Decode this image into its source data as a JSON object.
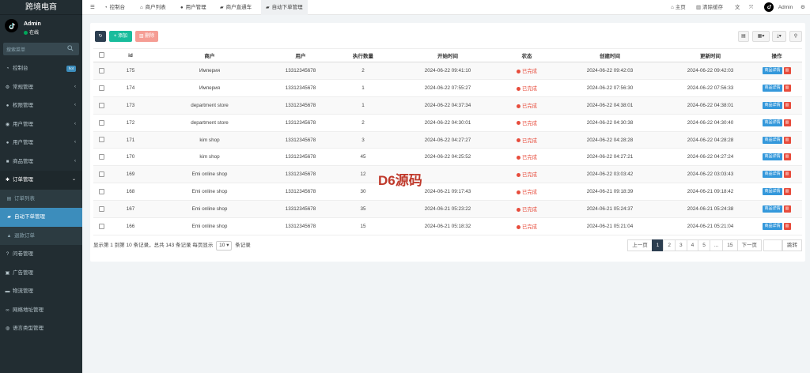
{
  "brand": "跨境电商",
  "user": {
    "name": "Admin",
    "status": "在线"
  },
  "search": {
    "placeholder": "搜索菜单"
  },
  "menu": [
    {
      "label": "控制台",
      "icon": "dashboard-icon",
      "badge": "hot"
    },
    {
      "label": "常规管理",
      "icon": "gears-icon"
    },
    {
      "label": "权限管理",
      "icon": "group-icon"
    },
    {
      "label": "用户管理",
      "icon": "user-icon"
    },
    {
      "label": "用户管理",
      "icon": "apple-icon"
    },
    {
      "label": "商品管理",
      "icon": "gift-icon"
    },
    {
      "label": "订单管理",
      "icon": "gear-icon"
    },
    {
      "label": "订单列表",
      "icon": "list-icon"
    },
    {
      "label": "自动下单管理",
      "icon": "car-icon"
    },
    {
      "label": "退款订单",
      "icon": "bank-icon"
    },
    {
      "label": "问卷管理",
      "icon": "question-icon"
    },
    {
      "label": "广告管理",
      "icon": "image-icon"
    },
    {
      "label": "物流管理",
      "icon": "truck-icon"
    },
    {
      "label": "网络地址管理",
      "icon": "link-icon"
    },
    {
      "label": "语言类型管理",
      "icon": "globe-icon"
    }
  ],
  "tabs": [
    {
      "label": "控制台",
      "icon": "dashboard-icon"
    },
    {
      "label": "商户列表",
      "icon": "home-icon"
    },
    {
      "label": "用户管理",
      "icon": "user-icon"
    },
    {
      "label": "商户直通车",
      "icon": "car-icon"
    },
    {
      "label": "自动下单管理",
      "icon": "car-icon"
    }
  ],
  "topright": {
    "home": "主页",
    "clear_cache": "清除缓存",
    "admin": "Admin"
  },
  "toolbar": {
    "add": "添加",
    "delete": "删除"
  },
  "table": {
    "headers": [
      "id",
      "商户",
      "用户",
      "执行数量",
      "开始时间",
      "状态",
      "创建时间",
      "更新时间",
      "操作"
    ],
    "rows": [
      {
        "id": "175",
        "merchant": "Империя",
        "user": "13312345678",
        "qty": "2",
        "start": "2024-06-22 09:41:10",
        "status": "已完成",
        "created": "2024-06-22 09:42:03",
        "updated": "2024-06-22 09:42:03"
      },
      {
        "id": "174",
        "merchant": "Империя",
        "user": "13312345678",
        "qty": "1",
        "start": "2024-06-22 07:55:27",
        "status": "已完成",
        "created": "2024-06-22 07:56:30",
        "updated": "2024-06-22 07:56:33"
      },
      {
        "id": "173",
        "merchant": "department store",
        "user": "13312345678",
        "qty": "1",
        "start": "2024-06-22 04:37:34",
        "status": "已完成",
        "created": "2024-06-22 04:38:01",
        "updated": "2024-06-22 04:38:01"
      },
      {
        "id": "172",
        "merchant": "department store",
        "user": "13312345678",
        "qty": "2",
        "start": "2024-06-22 04:30:01",
        "status": "已完成",
        "created": "2024-06-22 04:30:38",
        "updated": "2024-06-22 04:30:40"
      },
      {
        "id": "171",
        "merchant": "kim shop",
        "user": "13312345678",
        "qty": "3",
        "start": "2024-06-22 04:27:27",
        "status": "已完成",
        "created": "2024-06-22 04:28:28",
        "updated": "2024-06-22 04:28:28"
      },
      {
        "id": "170",
        "merchant": "kim shop",
        "user": "13312345678",
        "qty": "45",
        "start": "2024-06-22 04:25:52",
        "status": "已完成",
        "created": "2024-06-22 04:27:21",
        "updated": "2024-06-22 04:27:24"
      },
      {
        "id": "169",
        "merchant": "Emi online shop",
        "user": "13312345678",
        "qty": "12",
        "start": "",
        "status": "已完成",
        "created": "2024-06-22 03:03:42",
        "updated": "2024-06-22 03:03:43"
      },
      {
        "id": "168",
        "merchant": "Emi online shop",
        "user": "13312345678",
        "qty": "30",
        "start": "2024-06-21 09:17:43",
        "status": "已完成",
        "created": "2024-06-21 09:18:39",
        "updated": "2024-06-21 09:18:42"
      },
      {
        "id": "167",
        "merchant": "Emi online shop",
        "user": "13312345678",
        "qty": "35",
        "start": "2024-06-21 05:23:22",
        "status": "已完成",
        "created": "2024-06-21 05:24:37",
        "updated": "2024-06-21 05:24:38"
      },
      {
        "id": "166",
        "merchant": "Emi online shop",
        "user": "13312345678",
        "qty": "15",
        "start": "2024-06-21 05:18:32",
        "status": "已完成",
        "created": "2024-06-21 05:21:04",
        "updated": "2024-06-21 05:21:04"
      }
    ],
    "detail_label": "商品详情"
  },
  "pagination": {
    "info_prefix": "显示第 1 到第 10 条记录，总共 143 条记录 每页显示",
    "page_size": "10",
    "info_suffix": "条记录",
    "prev": "上一页",
    "pages": [
      "1",
      "2",
      "3",
      "4",
      "5",
      "...",
      "15"
    ],
    "next": "下一页",
    "jump": "跳转"
  },
  "watermark": "D6源码",
  "colors": {
    "sidebar_bg": "#222d32",
    "active": "#3c8dbc",
    "add": "#18bc9c",
    "danger": "#e74c3c",
    "detail": "#3498db"
  }
}
